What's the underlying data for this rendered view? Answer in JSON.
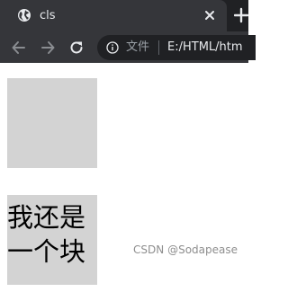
{
  "tab": {
    "title": "cls",
    "favicon": "globe-icon",
    "close_icon": "close-icon"
  },
  "toolbar": {
    "new_tab_icon": "plus-icon",
    "back_icon": "back-arrow-icon",
    "forward_icon": "forward-arrow-icon",
    "reload_icon": "reload-icon",
    "info_icon": "info-icon",
    "scheme_label": "文件",
    "url": "E:/HTML/htm"
  },
  "page": {
    "blocks": [
      {
        "text": ""
      },
      {
        "text": "我还是一个块"
      }
    ],
    "block_color": "#d3d3d3"
  },
  "watermark": "CSDN @Sodapease",
  "colors": {
    "tabstrip": "#202124",
    "tab": "#35363a",
    "omnibox": "#202124",
    "text_light": "#e8eaed"
  }
}
